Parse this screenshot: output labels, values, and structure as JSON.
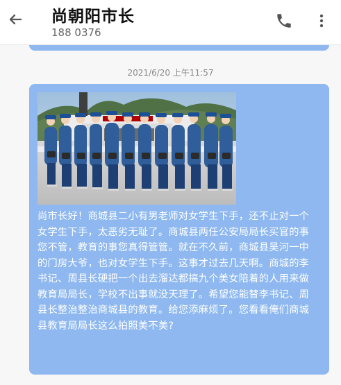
{
  "header": {
    "title": "尚朝阳市长",
    "subtitle": "188 0376"
  },
  "messages": [
    {
      "timestamp": "2021/6/20 上午11:57",
      "text": "尚市长好！商城县二小有男老师对女学生下手，还不止对一个女学生下手，太恶劣无耻了。商城县两任公安局局长买官的事您不管，教育的事您真得管管。就在不久前，商城县吴河一中的门房大爷，也对女学生下手。这事才过去几天啊。商城的李书记、周县长硬把一个出去溜达都搞九个美女陪着的人用来做教育局局长，学校不出事就没天理了。希望您能替李书记、周县长整治整治商城县的教育。给您添麻烦了。您看看俺们商城县教育局局长这么拍照美不美?"
    }
  ],
  "colors": {
    "bubble": "#8eb8ef",
    "header_bg": "#ffffff",
    "chat_bg": "#f7f7f7"
  },
  "icons": {
    "back": "arrow-left-icon",
    "phone": "phone-icon",
    "more": "more-vertical-icon"
  }
}
